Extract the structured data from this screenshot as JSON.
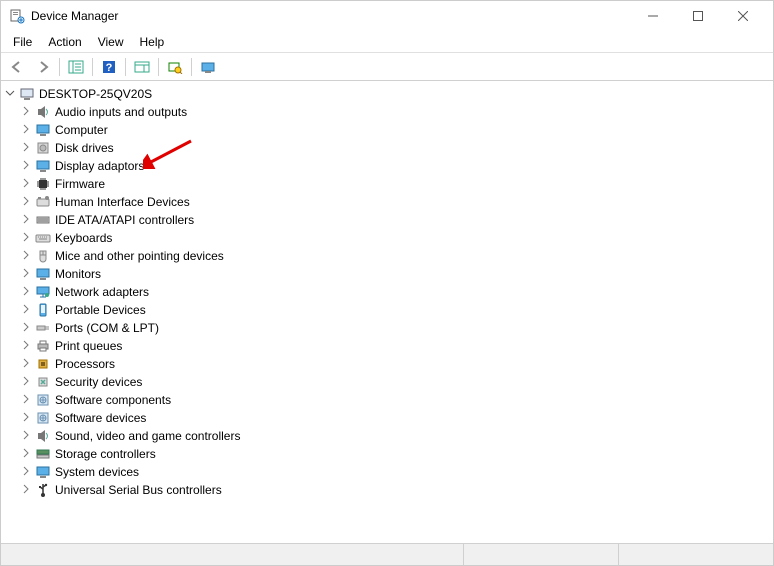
{
  "window": {
    "title": "Device Manager"
  },
  "menubar": [
    "File",
    "Action",
    "View",
    "Help"
  ],
  "tree": {
    "root_label": "DESKTOP-25QV20S",
    "children": [
      {
        "label": "Audio inputs and outputs",
        "icon": "speaker"
      },
      {
        "label": "Computer",
        "icon": "monitor"
      },
      {
        "label": "Disk drives",
        "icon": "disk"
      },
      {
        "label": "Display adaptors",
        "icon": "monitor"
      },
      {
        "label": "Firmware",
        "icon": "chip"
      },
      {
        "label": "Human Interface Devices",
        "icon": "hid"
      },
      {
        "label": "IDE ATA/ATAPI controllers",
        "icon": "ide"
      },
      {
        "label": "Keyboards",
        "icon": "keyboard"
      },
      {
        "label": "Mice and other pointing devices",
        "icon": "mouse"
      },
      {
        "label": "Monitors",
        "icon": "monitor"
      },
      {
        "label": "Network adapters",
        "icon": "network"
      },
      {
        "label": "Portable Devices",
        "icon": "portable"
      },
      {
        "label": "Ports (COM & LPT)",
        "icon": "port"
      },
      {
        "label": "Print queues",
        "icon": "printer"
      },
      {
        "label": "Processors",
        "icon": "cpu"
      },
      {
        "label": "Security devices",
        "icon": "security"
      },
      {
        "label": "Software components",
        "icon": "software"
      },
      {
        "label": "Software devices",
        "icon": "software"
      },
      {
        "label": "Sound, video and game controllers",
        "icon": "speaker"
      },
      {
        "label": "Storage controllers",
        "icon": "storage"
      },
      {
        "label": "System devices",
        "icon": "system"
      },
      {
        "label": "Universal Serial Bus controllers",
        "icon": "usb"
      }
    ]
  },
  "annotation": {
    "arrow_target_index": 3
  }
}
